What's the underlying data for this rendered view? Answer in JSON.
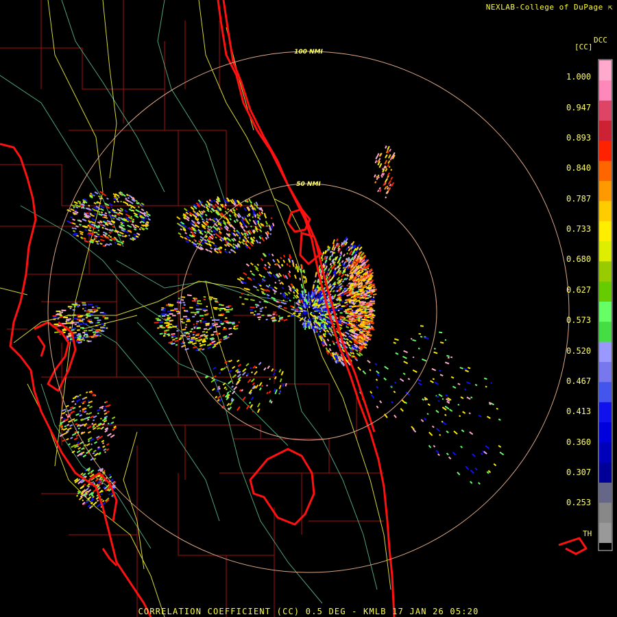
{
  "header": {
    "credit": "NEXLAB-College of DuPage",
    "credit_icon": "cursor-arrow-icon"
  },
  "legend": {
    "product_code": "DCC",
    "units": "[CC]",
    "labels": [
      "1.000",
      "0.947",
      "0.893",
      "0.840",
      "0.787",
      "0.733",
      "0.680",
      "0.627",
      "0.573",
      "0.520",
      "0.467",
      "0.413",
      "0.360",
      "0.307",
      "0.253"
    ],
    "threshold_label": "TH",
    "colors": [
      "#ffaacc",
      "#ff88bb",
      "#dd4466",
      "#cc2233",
      "#ff2200",
      "#ff6600",
      "#ff9900",
      "#ffcc00",
      "#ffee00",
      "#ddee00",
      "#99cc00",
      "#66cc00",
      "#66ff66",
      "#44dd44",
      "#9999ff",
      "#7777ee",
      "#4455ee",
      "#1111ee",
      "#0000dd",
      "#0000bb",
      "#000099",
      "#666688",
      "#888888",
      "#999999"
    ]
  },
  "rings": [
    {
      "label": "100 NMI",
      "range_nmi": 100
    },
    {
      "label": "50 NMI",
      "range_nmi": 50
    }
  ],
  "footer": {
    "text": "CORRELATION COEFFICIENT (CC) 0.5 DEG - KMLB 17 JAN 26 05:20"
  },
  "colors": {
    "background": "#000000",
    "coastline": "#ff1111",
    "county_lines": "#aa1111",
    "roads": "#ffff44",
    "rivers": "#66cc99",
    "range_rings": "#ddaa88",
    "text": "#ffff44"
  }
}
